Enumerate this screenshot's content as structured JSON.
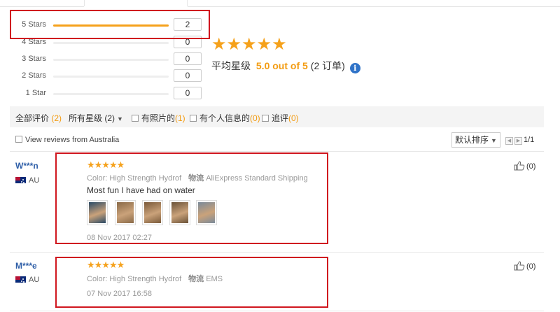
{
  "ratings": [
    {
      "label": "5 Stars",
      "count": "2",
      "fill": 1.0
    },
    {
      "label": "4 Stars",
      "count": "0",
      "fill": 0
    },
    {
      "label": "3 Stars",
      "count": "0",
      "fill": 0
    },
    {
      "label": "2 Stars",
      "count": "0",
      "fill": 0
    },
    {
      "label": "1 Star",
      "count": "0",
      "fill": 0
    }
  ],
  "summary": {
    "stars": "★★★★★",
    "label": "平均星级",
    "value": "5.0 out of 5",
    "orders": "(2 订单)",
    "info_icon": "info-icon"
  },
  "filters": {
    "all_label": "全部评价",
    "all_count": "(2)",
    "star_label": "所有星级 (2)",
    "photo_label": "有照片的",
    "photo_count": "(1)",
    "personal_label": "有个人信息的",
    "personal_count": "(0)",
    "followup_label": "追评",
    "followup_count": "(0)"
  },
  "country_filter": "View reviews from Australia",
  "sort_label": "默认排序",
  "pager": "1/1",
  "reviews": [
    {
      "name": "W***n",
      "country": "AU",
      "stars": "★★★★★",
      "color_label": "Color:",
      "color_value": "High Strength Hydrof",
      "shipping_label": "物流",
      "shipping_value": "AliExpress Standard Shipping",
      "text": "Most fun I have had on water",
      "photos": [
        "#2a4a66",
        "#8a6a48",
        "#7a5a3a",
        "#6a5238",
        "#7a8a9a"
      ],
      "date": "08 Nov 2017 02:27",
      "likes": "(0)"
    },
    {
      "name": "M***e",
      "country": "AU",
      "stars": "★★★★★",
      "color_label": "Color:",
      "color_value": "High Strength Hydrof",
      "shipping_label": "物流",
      "shipping_value": "EMS",
      "date": "07 Nov 2017 16:58",
      "likes": "(0)"
    }
  ]
}
